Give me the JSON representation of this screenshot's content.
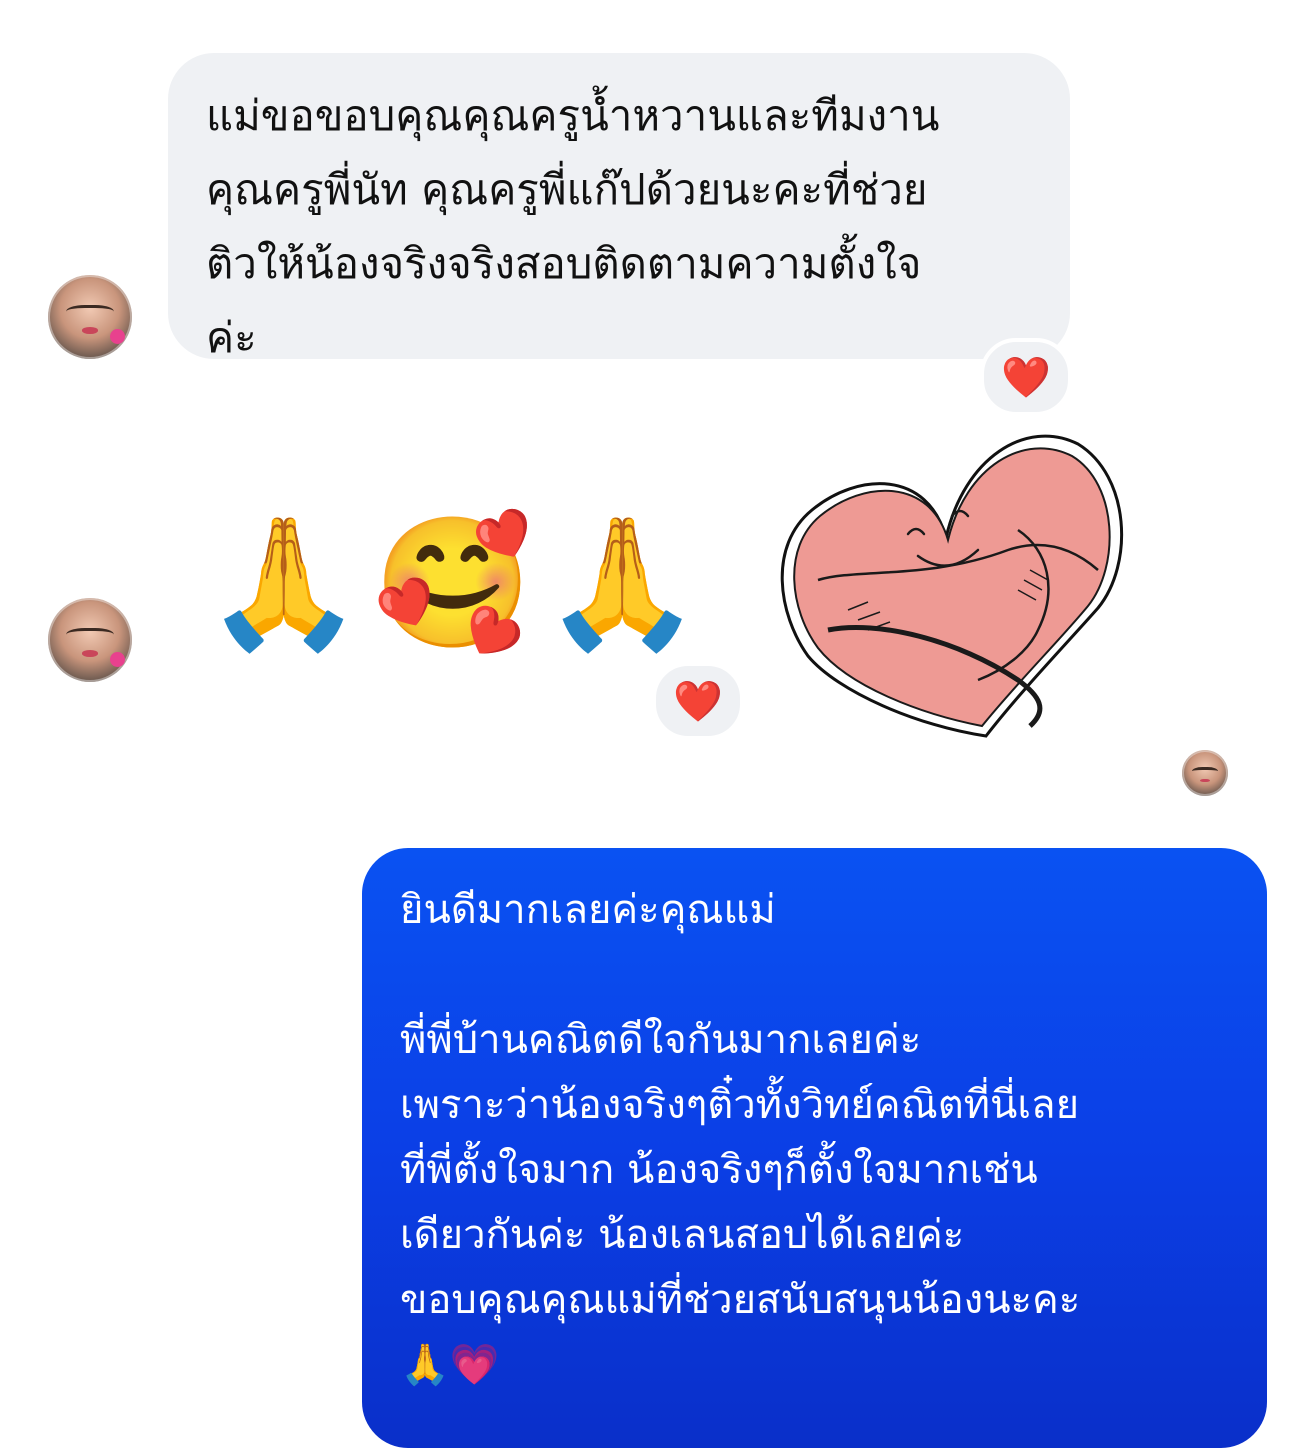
{
  "incoming_message": {
    "lines": [
      "แม่ขอขอบคุณคุณครูน้ำหวานและทีมงาน",
      "คุณครูพี่นัท คุณครูพี่แก๊ปด้วยนะคะที่ช่วย",
      "ติวให้น้องจริงจริงสอบติดตามความตั้งใจ",
      "ค่ะ"
    ],
    "reaction": "❤️"
  },
  "emoji_message": {
    "emojis": [
      "🙏",
      "🥰",
      "🙏"
    ],
    "reaction": "❤️"
  },
  "sticker": {
    "icon": "hugging-heart-sticker"
  },
  "outgoing_message": {
    "lines": [
      "ยินดีมากเลยค่ะคุณแม่",
      "",
      "พี่พี่บ้านคณิตดีใจกันมากเลยค่ะ",
      "เพราะว่าน้องจริงๆติ๋วทั้งวิทย์คณิตที่นี่เลย",
      "ที่พี่ตั้งใจมาก  น้องจริงๆก็ตั้งใจมากเช่น",
      "เดียวกันค่ะ น้องเลนสอบได้เลยค่ะ",
      "ขอบคุณคุณแม่ที่ช่วยสนับสนุนน้องนะคะ",
      "🙏💗"
    ]
  },
  "colors": {
    "incoming_bubble": "#eff1f4",
    "outgoing_bubble": "#0b43ea",
    "reaction_heart": "#e3142c"
  }
}
